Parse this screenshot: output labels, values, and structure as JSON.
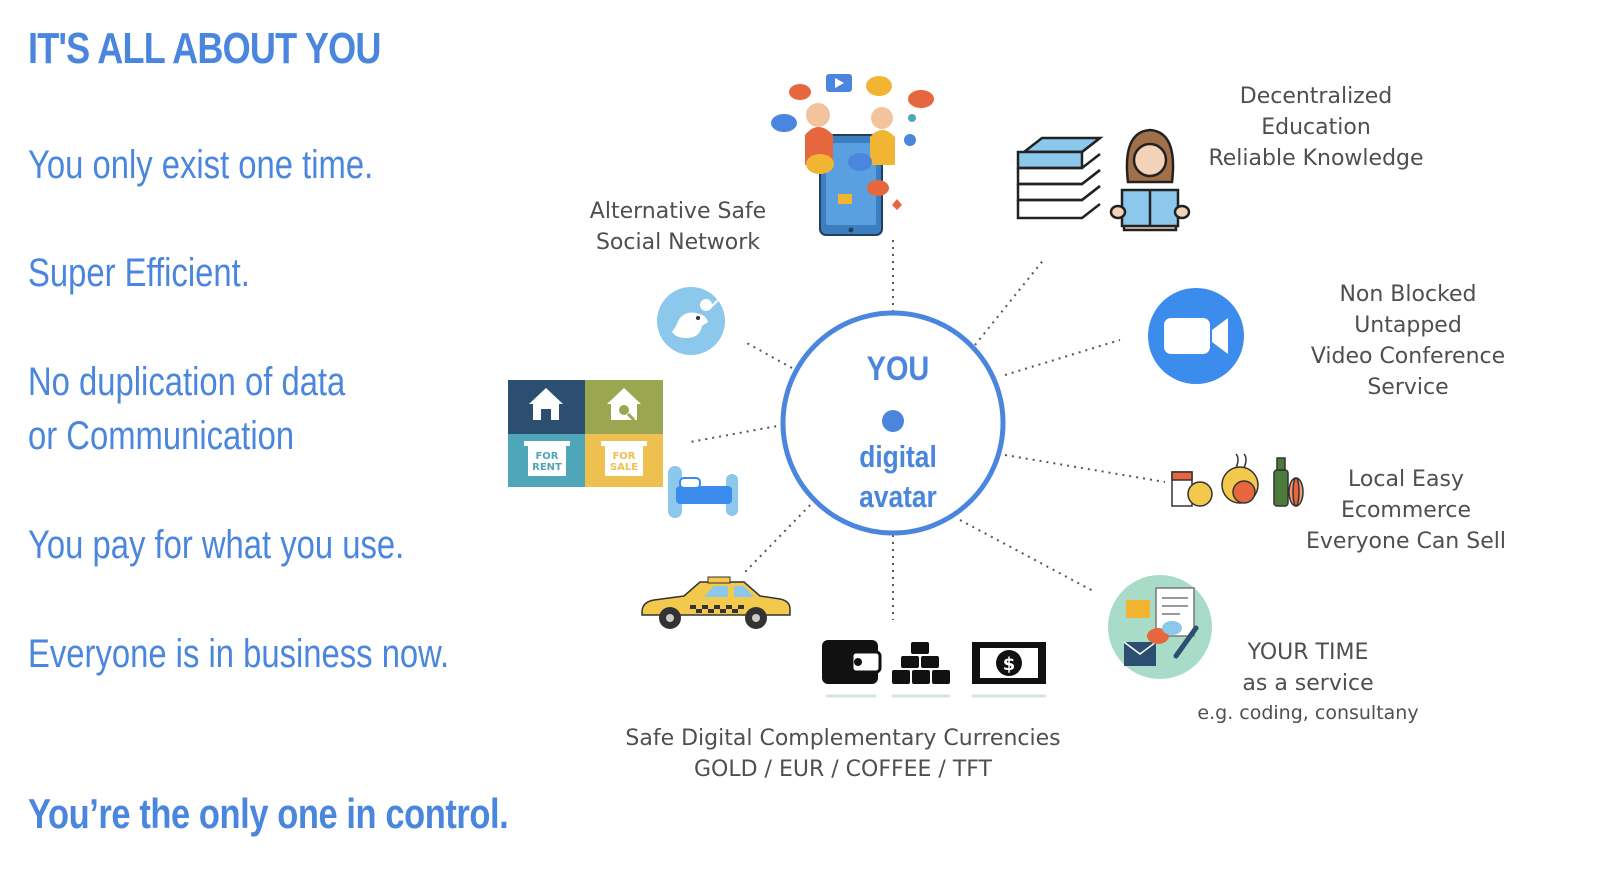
{
  "title": "IT'S ALL ABOUT YOU",
  "statements": [
    "You only exist one time.",
    "Super Efficient.",
    "No duplication of data",
    "or Communication",
    "You pay for what you use.",
    "Everyone is in business now."
  ],
  "control": "You’re the only one in control.",
  "center": {
    "line1": "YOU",
    "line2": "digital",
    "line3": "avatar"
  },
  "labels": {
    "social": [
      "Alternative Safe",
      "Social Network"
    ],
    "education": [
      "Decentralized",
      "Education",
      "Reliable Knowledge"
    ],
    "video": [
      "Non Blocked",
      "Untapped",
      "Video Conference",
      "Service"
    ],
    "ecommerce": [
      "Local Easy",
      "Ecommerce",
      "Everyone Can Sell"
    ],
    "time": [
      "YOUR TIME",
      "as a service",
      "e.g. coding, consultany"
    ],
    "currencies": [
      "Safe Digital Complementary Currencies",
      "GOLD / EUR / COFFEE / TFT"
    ]
  },
  "rental_tiles": {
    "for_rent": [
      "FOR",
      "RENT"
    ],
    "for_sale": [
      "FOR",
      "SALE"
    ]
  },
  "colors": {
    "accent": "#4a86de",
    "circle": "#4a86de",
    "label": "#4f4f4f",
    "tile_navy": "#2c4f71",
    "tile_olive": "#9aa650",
    "tile_teal": "#4ea6b8",
    "tile_gold": "#eec04f",
    "zoom_blue": "#3b8ced",
    "taxi_yellow": "#f2c94c"
  },
  "icons": [
    "social-network-icon",
    "education-books-icon",
    "reader-person-icon",
    "video-camera-icon",
    "groceries-icon",
    "time-service-icon",
    "wallet-icon",
    "gold-bars-icon",
    "dollar-bill-icon",
    "taxi-icon",
    "bed-icon",
    "house-icon",
    "bird-icon"
  ]
}
